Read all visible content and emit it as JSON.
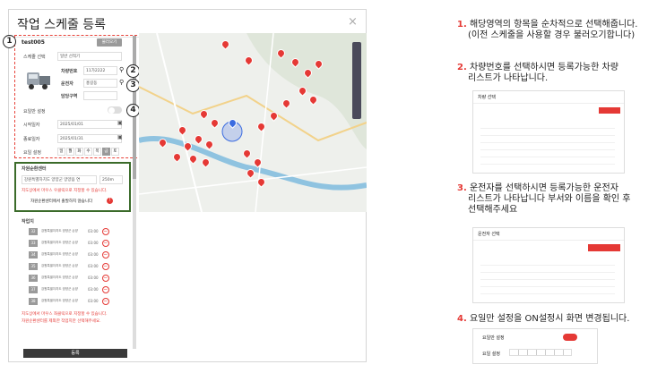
{
  "dialog": {
    "title": "작업 스케줄 등록",
    "close": "×"
  },
  "form": {
    "name": "test005",
    "load_btn": "불러오기",
    "schedule_label": "스케줄 선택",
    "schedule_value": "일반 선적기",
    "car_label": "차량번호",
    "car_value": "11가2222",
    "driver_label": "운전자",
    "driver_value": "홍길동",
    "area_label": "담당구역",
    "area_value": "",
    "repeat_label": "요일반 설정",
    "start_label": "시작일자",
    "start_value": "2025/01/01",
    "end_label": "종료일자",
    "end_value": "2025/01/31",
    "weekday_label": "요일 설정",
    "weekdays": [
      "일",
      "월",
      "화",
      "수",
      "목",
      "금",
      "토"
    ]
  },
  "markers": [
    "1",
    "2",
    "3",
    "4"
  ],
  "center": {
    "title": "자원순환센터",
    "select": "강원특별자치도 양양군 양양읍 연",
    "dist": "250m",
    "warn": "지도상에서 마우스 우클릭으로 지정할 수 있습니다.",
    "note": "자원순환센터에서 출발하지 않습니다"
  },
  "worklist": {
    "title": "작업지",
    "items": [
      {
        "no": "32",
        "addr": "강원특별자치도 양양군 손양",
        "time": "03:00"
      },
      {
        "no": "33",
        "addr": "강원특별자치도 양양군 손양",
        "time": "03:00"
      },
      {
        "no": "34",
        "addr": "강원특별자치도 양양군 손양",
        "time": "03:00"
      },
      {
        "no": "35",
        "addr": "강원특별자치도 양양군 손양",
        "time": "03:00"
      },
      {
        "no": "36",
        "addr": "강원특별자치도 양양군 손양",
        "time": "03:00"
      },
      {
        "no": "37",
        "addr": "강원특별자치도 양양군 손양",
        "time": "03:00"
      },
      {
        "no": "38",
        "addr": "강원특별자치도 양양군 손양",
        "time": "03:00"
      }
    ],
    "warn1": "지도상에서 마우스 좌클릭으로 지정할 수 있습니다.",
    "warn2": "자원순환센터를 제외한 작업지만 선택해주세요.",
    "submit": "등록"
  },
  "guide": {
    "s1_num": "1.",
    "s1_a": "해당영역의 항목을 순차적으로 선택해줍니다.",
    "s1_b": "(이전 스케줄을 사용할 경우 불러오기합니다)",
    "s2_num": "2.",
    "s2_a": "차량번호를 선택하시면 등록가능한 차량",
    "s2_b": "리스트가 나타납니다.",
    "s3_num": "3.",
    "s3_a": "운전자를 선택하시면 등록가능한 운전자",
    "s3_b": "리스트가 나타납니다 부서와 이름을 확인 후",
    "s3_c": "선택해주세요",
    "s4_num": "4.",
    "s4_a": "요일만 설정을 ON설정시 화면 변경됩니다.",
    "mini2_title": "차량 선택",
    "mini3_title": "운전자 선택",
    "mini4_repeat": "요일만 설정",
    "mini4_weekday": "요일 설정"
  },
  "accent": "#e53935"
}
